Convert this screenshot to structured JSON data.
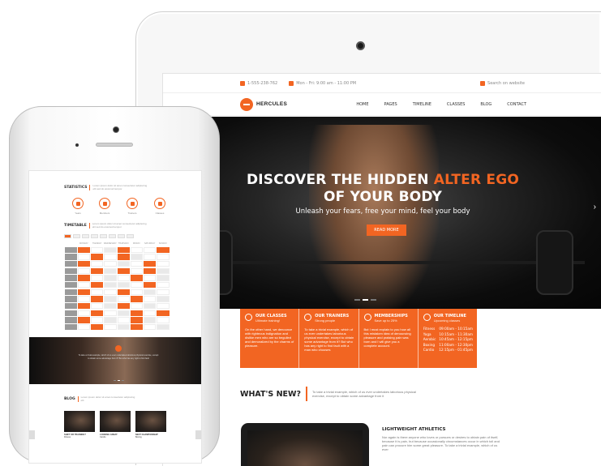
{
  "colors": {
    "accent": "#f26522",
    "dark": "#111111"
  },
  "tablet": {
    "topbar": {
      "phone": "1-555-238-762",
      "hours": "Mon - Fri: 9:00 am - 11:00 PM",
      "search_placeholder": "Search on website",
      "icons": [
        "phone-icon",
        "clock-icon",
        "search-icon"
      ]
    },
    "nav": {
      "logo": "HERCULES",
      "menu": [
        "HOME",
        "PAGES",
        "TIMELINE",
        "CLASSES",
        "BLOG",
        "CONTACT"
      ]
    },
    "hero": {
      "title_part1": "DISCOVER THE HIDDEN ",
      "title_accent": "ALTER EGO",
      "title_line2": "OF YOUR BODY",
      "subtitle": "Unleash your fears, free your mind, feel your body",
      "button": "READ MORE",
      "arrow": "›"
    },
    "features": [
      {
        "title": "OUR CLASSES",
        "subtitle": "Ultimate training!",
        "text": "On the other hand, we denounce with righteous indignation and dislike men who are so beguiled and demoralized by the charms of pleasure."
      },
      {
        "title": "OUR TRAINERS",
        "subtitle": "Strong people",
        "text": "To take a trivial example, which of us ever undertakes laborious physical exercise, except to obtain some advantage from it? But who has any right to find fault with a man who chooses"
      },
      {
        "title": "MEMBERSHIPS",
        "subtitle": "Save up to 25%",
        "text": "But I must explain to you how all this mistaken idea of denouncing pleasure and praising pain was born and I will give you a complete account."
      },
      {
        "title": "OUR TIMELINE",
        "subtitle": "Upcoming classes",
        "timeline": [
          {
            "name": "Fitness",
            "time": "09:00am - 10:15am"
          },
          {
            "name": "Yoga",
            "time": "10:15am - 11:30am"
          },
          {
            "name": "Aerobic",
            "time": "10:45am - 12:15pm"
          },
          {
            "name": "Boxing",
            "time": "11:00am - 12:30pm"
          },
          {
            "name": "Cardio",
            "time": "12:15pm - 01:45pm"
          }
        ]
      }
    ],
    "whats_new": {
      "title": "WHAT'S NEW?",
      "text": "To take a trivial example, which of us ever undertakes laborious physical exercise, except to obtain some advantage from it"
    },
    "article": {
      "title": "LIGHTWEIGHT ATHLETICS",
      "text": "Nor again is there anyone who loves or pursues or desires to obtain pain of itself, because it is pain, but because occasionally circumstances occur in which toil and pain can procure him some great pleasure. To take a trivial example, which of us ever"
    }
  },
  "phone": {
    "statistics": {
      "title": "STATISTICS",
      "desc": "Lorem ipsum dolor sit amet consectetur adipiscing elit sed do eiusmod tempor",
      "items": [
        "Years",
        "Members",
        "Trainers",
        "Classes"
      ]
    },
    "timetable": {
      "title": "TIMETABLE",
      "desc": "Lorem ipsum dolor sit amet consectetur adipiscing elit sed do eiusmod tempor",
      "days": [
        "MONDAY",
        "TUESDAY",
        "WEDNESDAY",
        "THURSDAY",
        "FRIDAY",
        "SATURDAY",
        "SUNDAY"
      ]
    },
    "hero_text": "To take a trivial example, which of us ever undertakes laborious physical exercise, except to obtain some advantage from it? But who has any right to find fault",
    "blog": {
      "title": "BLOG",
      "desc": "Lorem ipsum dolor sit amet consectetur adipiscing elit",
      "posts": [
        {
          "title": "SHIFT OR TRAINING?",
          "meta": "Fitness"
        },
        {
          "title": "LOOKING GREAT",
          "meta": "Cardio"
        },
        {
          "title": "NEXT CHAMPIONSHIP",
          "meta": "Boxing"
        }
      ]
    }
  }
}
